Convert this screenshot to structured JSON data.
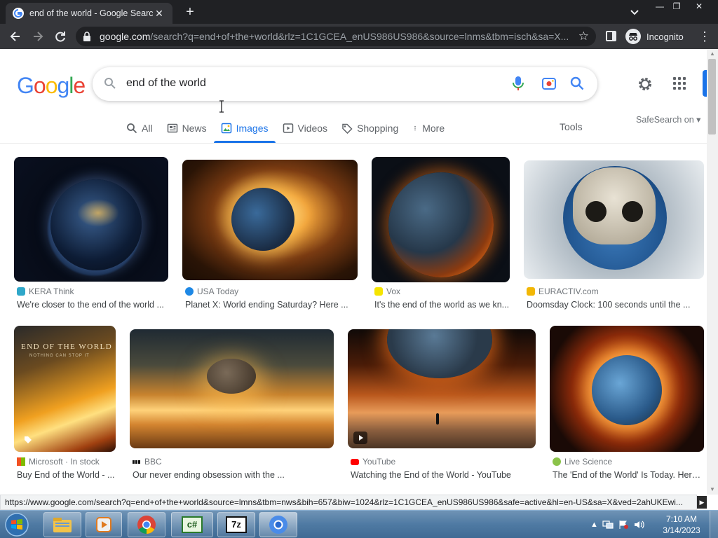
{
  "browser": {
    "tab_title": "end of the world - Google Search",
    "url_host": "google.com",
    "url_path": "/search?q=end+of+the+world&rlz=1C1GCEA_enUS986US986&source=lnms&tbm=isch&sa=X...",
    "profile_label": "Incognito",
    "window_min": "—",
    "window_max": "❐",
    "window_close": "✕"
  },
  "search": {
    "query": "end of the world",
    "tabs": [
      {
        "label": "All",
        "icon": "search-icon"
      },
      {
        "label": "News",
        "icon": "news-icon"
      },
      {
        "label": "Images",
        "icon": "images-icon",
        "active": true
      },
      {
        "label": "Videos",
        "icon": "play-icon"
      },
      {
        "label": "Shopping",
        "icon": "tag-icon"
      },
      {
        "label": "More",
        "icon": "dots-icon"
      }
    ],
    "tools_label": "Tools",
    "safesearch_label": "SafeSearch on ▾"
  },
  "results": [
    {
      "source": "KERA Think",
      "title": "We're closer to the end of the world ...",
      "source_color": "#2fa7c9"
    },
    {
      "source": "USA Today",
      "title": "Planet X: World ending Saturday? Here ...",
      "source_color": "#1e88e5"
    },
    {
      "source": "Vox",
      "title": "It's the end of the world as we kn...",
      "source_color": "#f5e400"
    },
    {
      "source": "EURACTIV.com",
      "title": "Doomsday Clock: 100 seconds until the ...",
      "source_color": "#f2b705"
    },
    {
      "source": "Microsoft · In stock",
      "title": "Buy End of the World - ...",
      "source_color": "#f25022",
      "overlay": "END OF THE WORLD",
      "overlay_sub": "NOTHING CAN STOP IT"
    },
    {
      "source": "BBC",
      "title": "Our never ending obsession with the ...",
      "source_color": "#111111"
    },
    {
      "source": "YouTube",
      "title": "Watching the End of the World - YouTube",
      "source_color": "#ff0000"
    },
    {
      "source": "Live Science",
      "title": "The 'End of the World' Is Today. Here'...",
      "source_color": "#8bc34a"
    }
  ],
  "status_url": "https://www.google.com/search?q=end+of+the+world&source=lmns&tbm=nws&bih=657&biw=1024&rlz=1C1GCEA_enUS986US986&safe=active&hl=en-US&sa=X&ved=2ahUKEwi...",
  "taskbar": {
    "time": "7:10 AM",
    "date": "3/14/2023",
    "apps": [
      "explorer-icon",
      "media-player-icon",
      "chrome-icon",
      "csharp-icon",
      "7zip-icon",
      "chromium-icon"
    ],
    "csharp_label": "c#",
    "sevenzip_label": "7z"
  },
  "colors": {
    "accent": "#1a73e8",
    "chrome_dark": "#202124",
    "chrome_toolbar": "#35363a"
  }
}
